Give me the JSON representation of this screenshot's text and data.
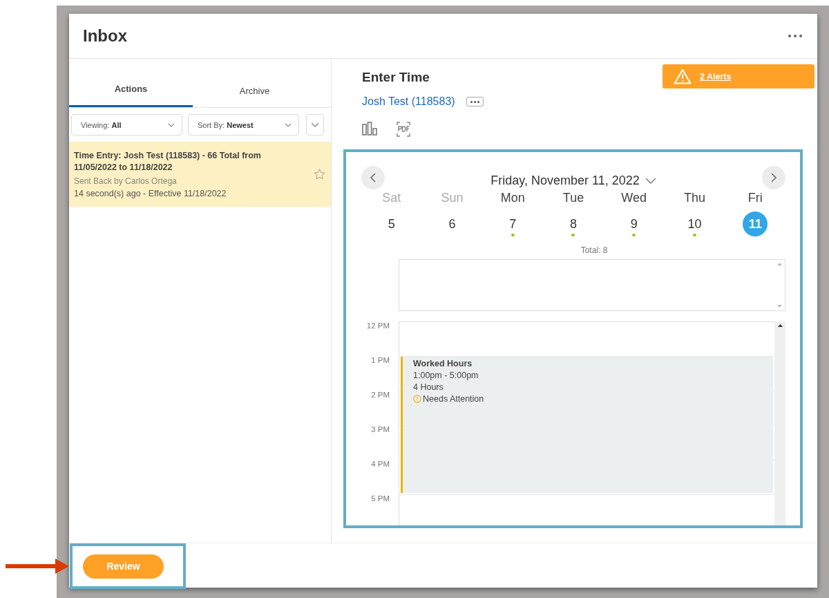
{
  "header": {
    "title": "Inbox"
  },
  "tabs": [
    {
      "label": "Actions",
      "selected": true
    },
    {
      "label": "Archive",
      "selected": false
    }
  ],
  "filters": [
    {
      "label": "Viewing:",
      "value": "All"
    },
    {
      "label": "Sort By:",
      "value": "Newest"
    }
  ],
  "inbox_items": [
    {
      "title": "Time Entry: Josh Test (118583) - 66 Total from 11/05/2022 to 11/18/2022",
      "sender": "Sent Back by Carlos Ortega",
      "meta": "14 second(s) ago - Effective 11/18/2022",
      "selected": true,
      "starred": false
    }
  ],
  "detail": {
    "title": "Enter Time",
    "worker": "Josh Test (118583)",
    "alerts": "2 Alerts"
  },
  "calendar": {
    "date": "Friday, November 11, 2022",
    "days": [
      {
        "weekday": "Sat",
        "date": "5",
        "weekend": true,
        "has_entry": false,
        "selected": false
      },
      {
        "weekday": "Sun",
        "date": "6",
        "weekend": true,
        "has_entry": false,
        "selected": false
      },
      {
        "weekday": "Mon",
        "date": "7",
        "weekend": false,
        "has_entry": true,
        "selected": false
      },
      {
        "weekday": "Tue",
        "date": "8",
        "weekend": false,
        "has_entry": true,
        "selected": false
      },
      {
        "weekday": "Wed",
        "date": "9",
        "weekend": false,
        "has_entry": true,
        "selected": false
      },
      {
        "weekday": "Thu",
        "date": "10",
        "weekend": false,
        "has_entry": true,
        "selected": false
      },
      {
        "weekday": "Fri",
        "date": "11",
        "weekend": false,
        "has_entry": false,
        "selected": true
      }
    ],
    "total": "Total: 8",
    "hours": [
      "12 PM",
      "1 PM",
      "2 PM",
      "3 PM",
      "4 PM",
      "5 PM"
    ],
    "events": [
      {
        "title": "Worked Hours",
        "time": "1:00pm - 5:00pm",
        "duration": "4 Hours",
        "status": "Needs Attention"
      }
    ]
  },
  "footer": {
    "button": "Review"
  }
}
